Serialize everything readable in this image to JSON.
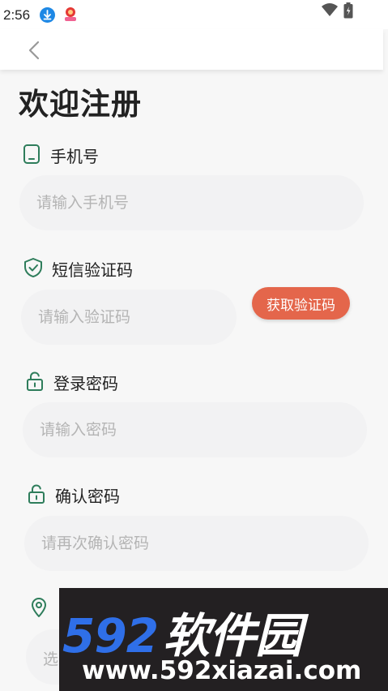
{
  "status_bar": {
    "time": "2:56",
    "icons": [
      "download-icon",
      "app-notification-icon",
      "wifi-icon",
      "battery-icon"
    ]
  },
  "header": {
    "back_icon": "chevron-left-icon"
  },
  "page": {
    "title": "欢迎注册"
  },
  "form": {
    "phone": {
      "label": "手机号",
      "placeholder": "请输入手机号",
      "icon": "phone-icon"
    },
    "sms_code": {
      "label": "短信验证码",
      "placeholder": "请输入验证码",
      "icon": "shield-check-icon",
      "button_label": "获取验证码"
    },
    "password": {
      "label": "登录密码",
      "placeholder": "请输入密码",
      "icon": "lock-icon"
    },
    "confirm_password": {
      "label": "确认密码",
      "placeholder": "请再次确认密码",
      "icon": "lock-icon"
    },
    "location": {
      "icon": "location-pin-icon",
      "placeholder_partial": "选"
    }
  },
  "watermark": {
    "digits": "592",
    "name": "软件园",
    "url": "www.592xiazai.com"
  },
  "colors": {
    "accent_green": "#2e7d5b",
    "button_orange": "#e4664b",
    "input_bg": "#f2f2f3",
    "watermark_blue": "#2f6fe8"
  }
}
